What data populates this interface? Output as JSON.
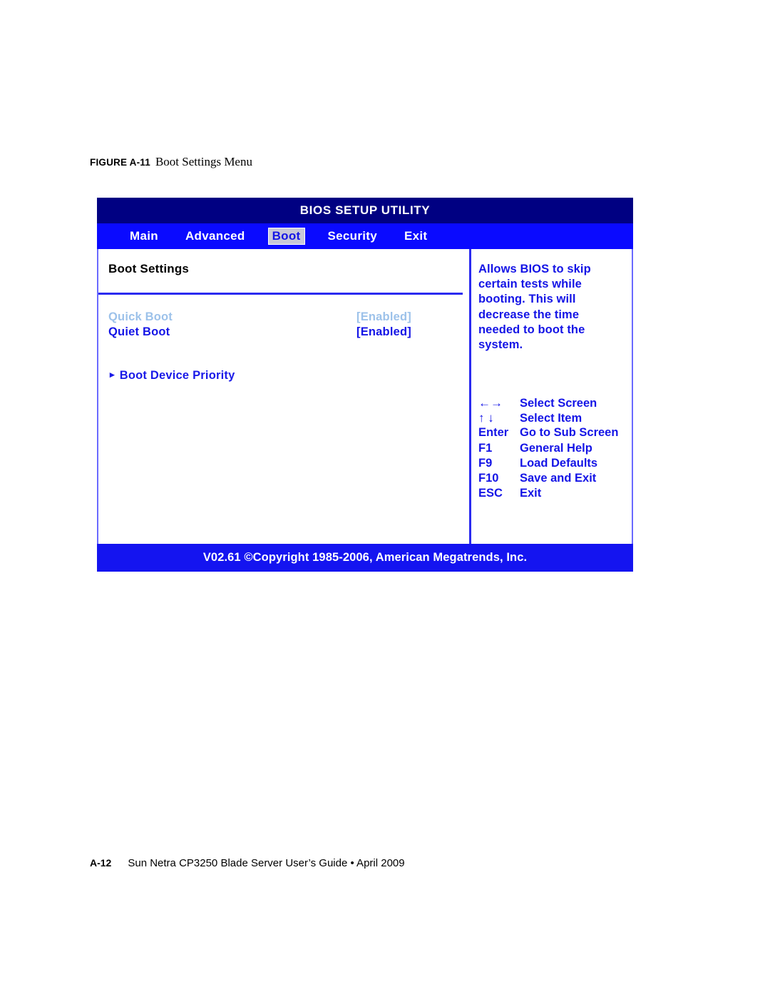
{
  "figure": {
    "label": "FIGURE A-11",
    "title": "Boot Settings Menu"
  },
  "bios": {
    "titlebar": "BIOS SETUP UTILITY",
    "menu": [
      {
        "label": "Main",
        "selected": false
      },
      {
        "label": "Advanced",
        "selected": false
      },
      {
        "label": "Boot",
        "selected": true
      },
      {
        "label": "Security",
        "selected": false
      },
      {
        "label": "Exit",
        "selected": false
      }
    ],
    "section_title": "Boot Settings",
    "settings": [
      {
        "label": "Quick Boot",
        "value": "[Enabled]",
        "state": "dim"
      },
      {
        "label": "Quiet Boot",
        "value": "[Enabled]",
        "state": "active"
      }
    ],
    "submenu": {
      "arrow": "▸",
      "label": "Boot Device Priority"
    },
    "help_text": "Allows BIOS to skip certain tests while booting. This will decrease the time needed to boot the system.",
    "key_legend": [
      {
        "key": "←→",
        "desc": "Select Screen",
        "arrows": true
      },
      {
        "key": "↑ ↓",
        "desc": "Select Item",
        "arrows": true
      },
      {
        "key": "Enter",
        "desc": "Go to Sub Screen",
        "arrows": false
      },
      {
        "key": "F1",
        "desc": "General Help",
        "arrows": false
      },
      {
        "key": "F9",
        "desc": "Load Defaults",
        "arrows": false
      },
      {
        "key": "F10",
        "desc": "Save and Exit",
        "arrows": false
      },
      {
        "key": "ESC",
        "desc": "Exit",
        "arrows": false
      }
    ],
    "footer": "V02.61 ©Copyright 1985-2006, American Megatrends, Inc."
  },
  "page_footer": {
    "page_number": "A-12",
    "text": "Sun Netra CP3250 Blade Server User’s Guide • April 2009"
  },
  "colors": {
    "titlebar_bg": "#000082",
    "menubar_bg": "#0a0aff",
    "selected_tab_bg": "#c8c8d8",
    "selected_tab_fg": "#1414e6",
    "accent_blue": "#1414e6",
    "dim_blue": "#9dc2ea",
    "footer_bg": "#1414f0",
    "rule_blue": "#2b2bf0"
  }
}
